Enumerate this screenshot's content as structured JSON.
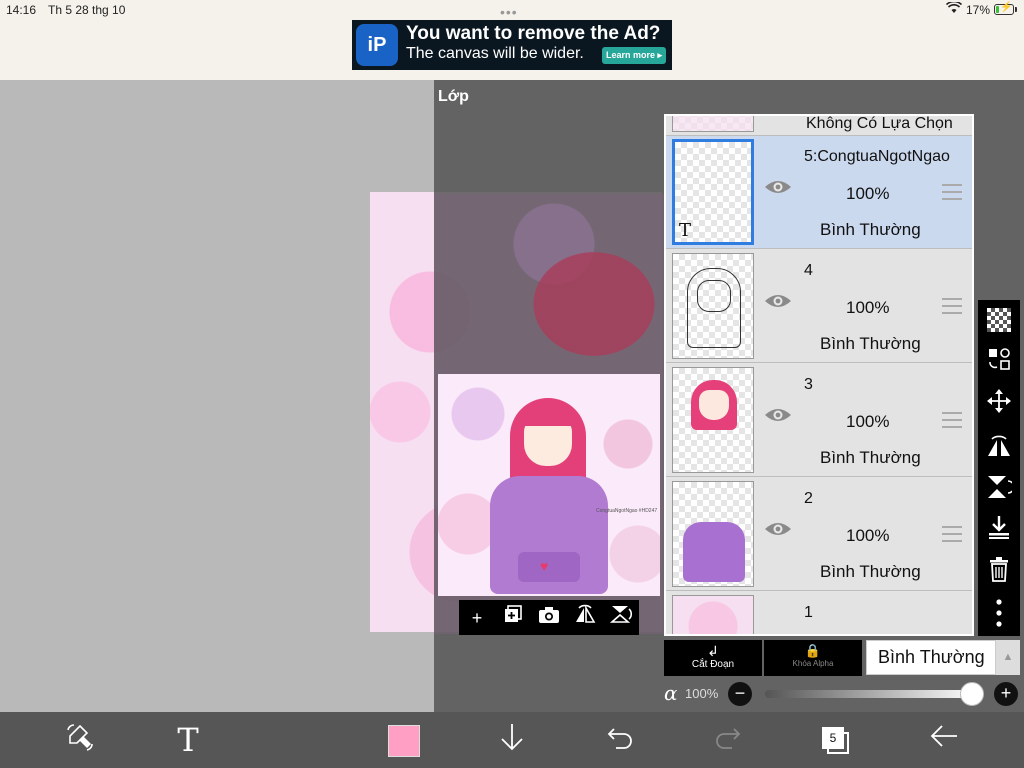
{
  "status_bar": {
    "time": "14:16",
    "date": "Th 5 28 thg 10",
    "battery_pct": "17%",
    "battery_level": 0.17,
    "dots": "•••"
  },
  "ad": {
    "logo": "iP",
    "title": "You want to remove the Ad?",
    "subtitle": "The canvas will be wider.",
    "learn_more": "Learn more ▸"
  },
  "panel": {
    "title": "Lớp"
  },
  "preview": {
    "signature": "CongtuaNgotNgao #HD247"
  },
  "layers": [
    {
      "name": "Không Có Lựa Chọn",
      "opacity": "",
      "mode": "",
      "selected": false
    },
    {
      "name": "5:CongtuaNgotNgao",
      "opacity": "100%",
      "mode": "Bình Thường",
      "selected": true,
      "thumb_badge": "T"
    },
    {
      "name": "4",
      "opacity": "100%",
      "mode": "Bình Thường",
      "selected": false
    },
    {
      "name": "3",
      "opacity": "100%",
      "mode": "Bình Thường",
      "selected": false
    },
    {
      "name": "2",
      "opacity": "100%",
      "mode": "Bình Thường",
      "selected": false
    },
    {
      "name": "1",
      "opacity": "",
      "mode": "",
      "selected": false
    }
  ],
  "blend": {
    "clip_label": "Cắt Đoạn",
    "alpha_lock_label": "Khóa Alpha",
    "mode_value": "Bình Thường",
    "alpha_symbol": "α",
    "alpha_value": "100%",
    "alpha_fraction": 1.0
  },
  "bottom_bar": {
    "layer_count": "5"
  },
  "colors": {
    "accent": "#2f7de0",
    "current_color": "#ff9fc4",
    "selected_row": "#cbd9ef"
  },
  "icons": {
    "wifi": "wifi-icon",
    "eye": "eye-icon",
    "checker": "checker-icon",
    "transform": "transform-icon",
    "move": "move-icon",
    "flip_h": "flip-horizontal-icon",
    "flip_v": "flip-vertical-icon",
    "merge_down": "merge-down-icon",
    "trash": "trash-icon",
    "more": "more-vertical-icon"
  }
}
